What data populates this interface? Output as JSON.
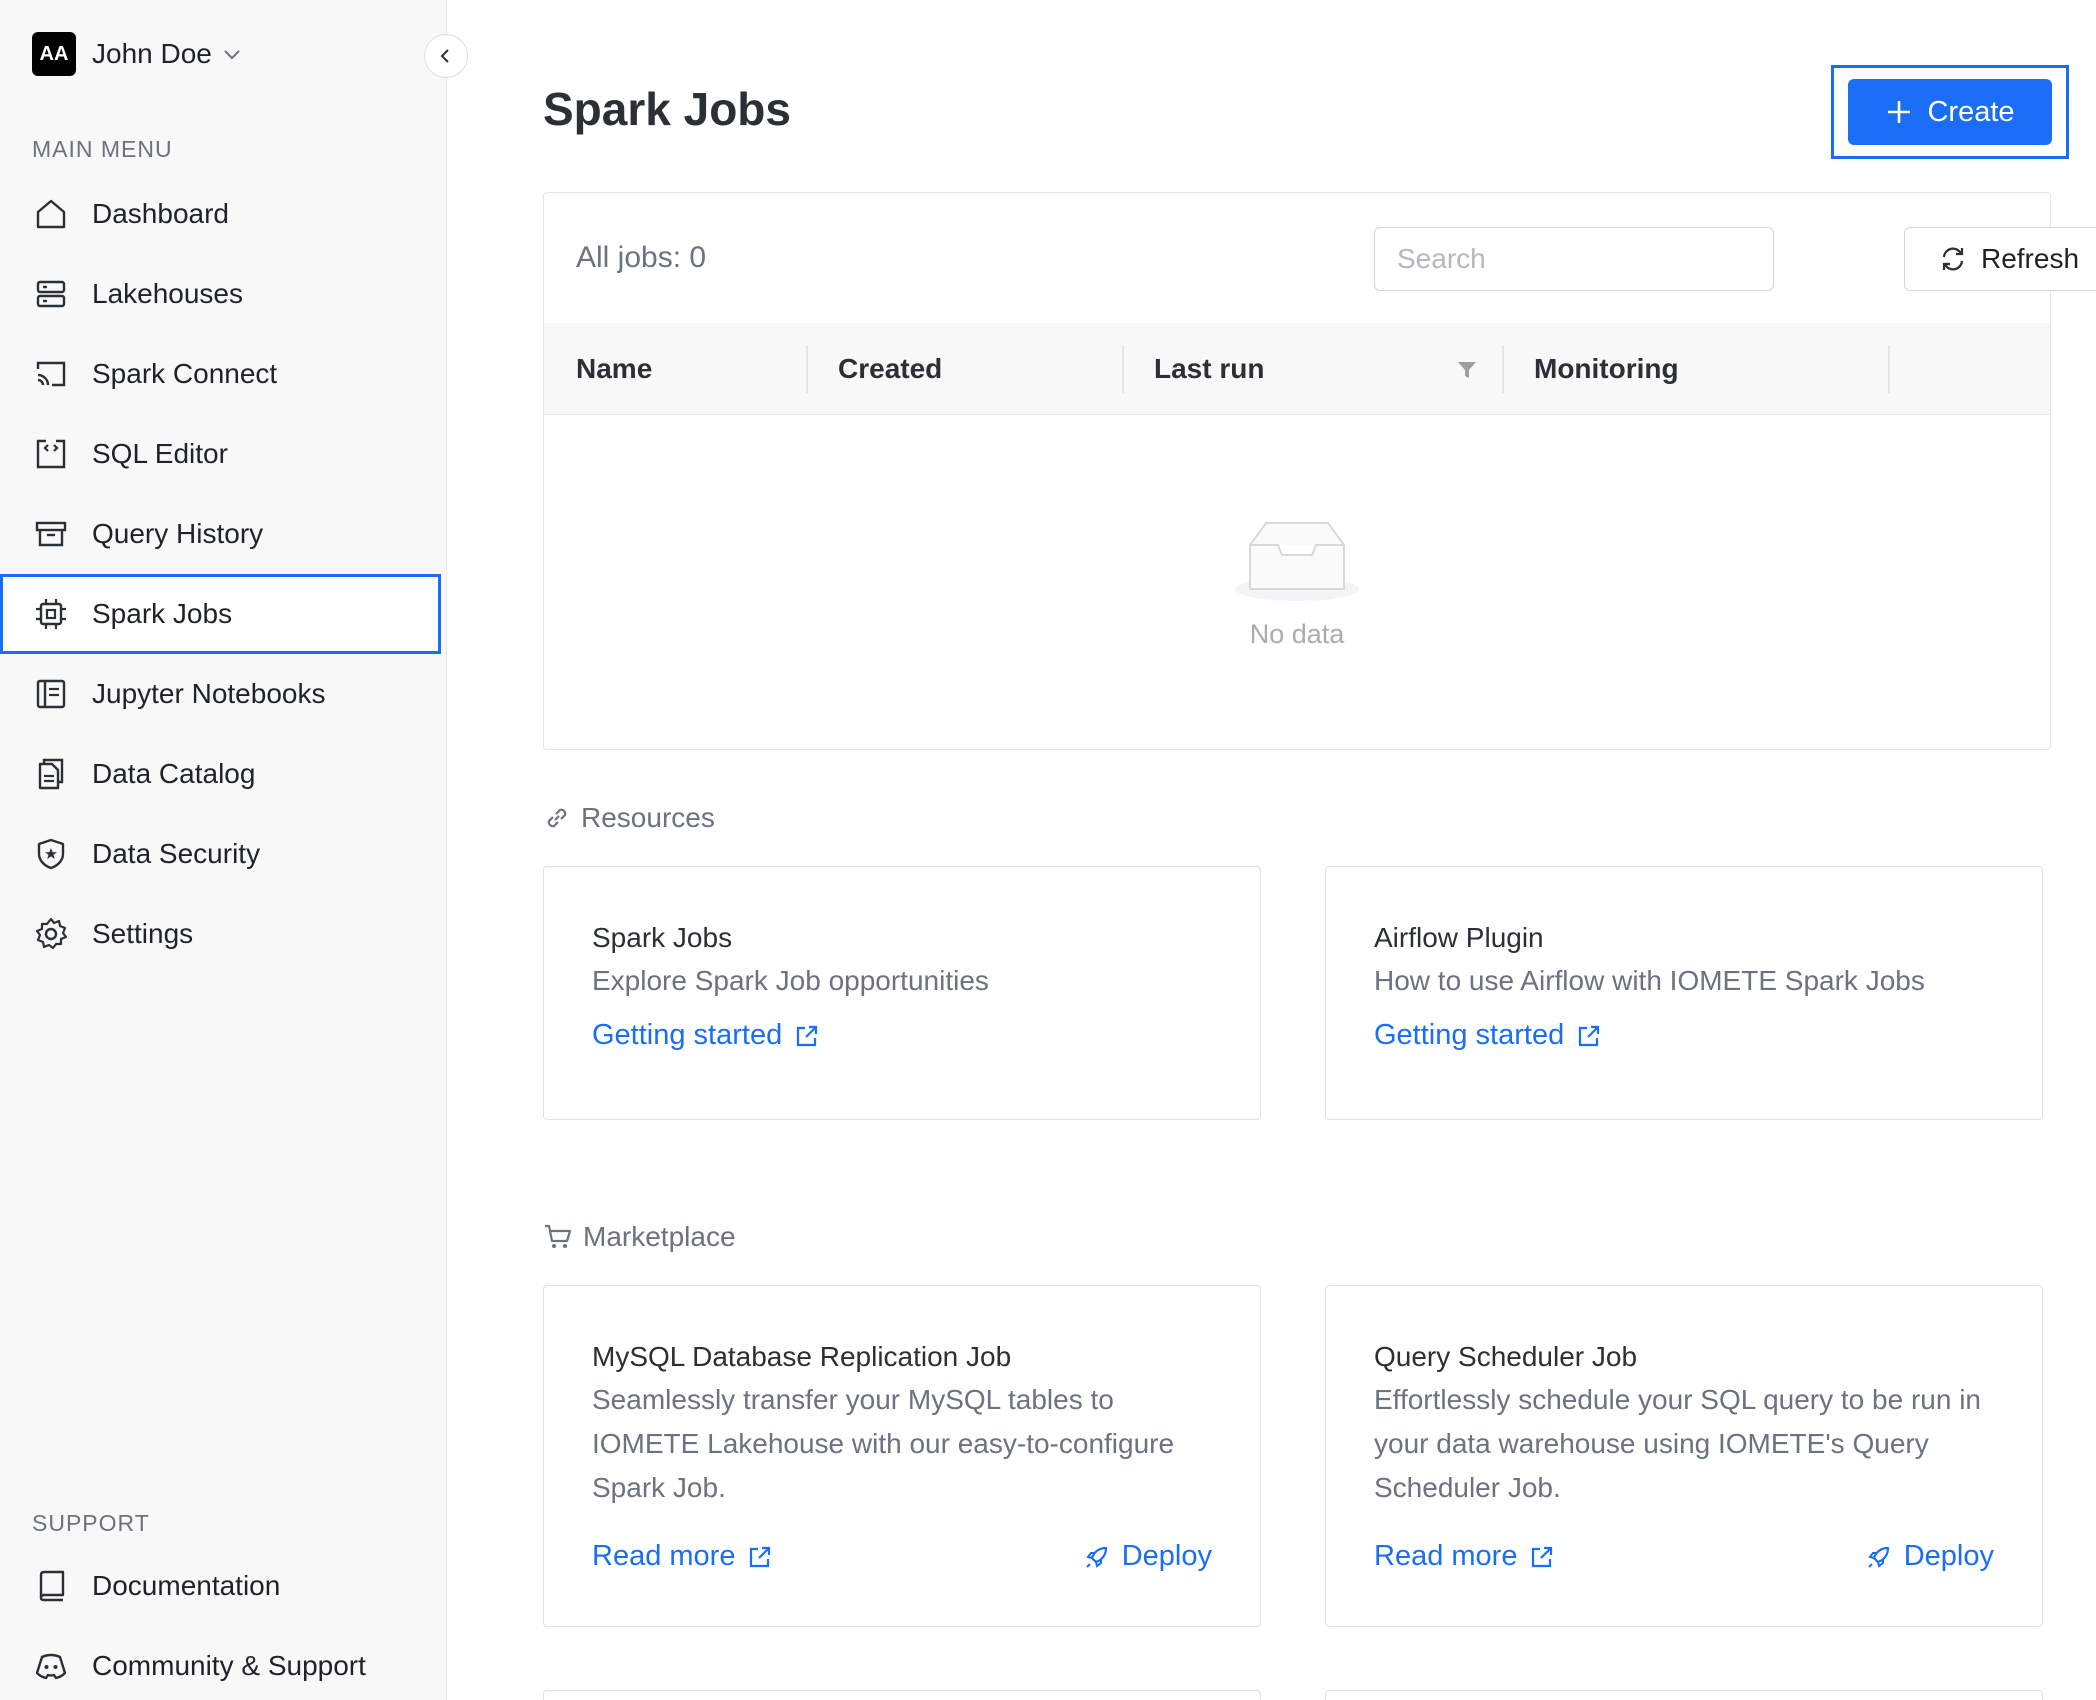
{
  "user": {
    "initials": "AA",
    "name": "John Doe"
  },
  "sidebar": {
    "main_menu_label": "MAIN MENU",
    "items": [
      {
        "label": "Dashboard",
        "icon": "home-icon"
      },
      {
        "label": "Lakehouses",
        "icon": "server-icon"
      },
      {
        "label": "Spark Connect",
        "icon": "cast-icon"
      },
      {
        "label": "SQL Editor",
        "icon": "code-file-icon"
      },
      {
        "label": "Query History",
        "icon": "archive-icon"
      },
      {
        "label": "Spark Jobs",
        "icon": "chip-icon",
        "active": true
      },
      {
        "label": "Jupyter Notebooks",
        "icon": "notebook-icon"
      },
      {
        "label": "Data Catalog",
        "icon": "catalog-icon"
      },
      {
        "label": "Data Security",
        "icon": "shield-star-icon"
      },
      {
        "label": "Settings",
        "icon": "gear-icon"
      }
    ],
    "support_label": "SUPPORT",
    "support_items": [
      {
        "label": "Documentation",
        "icon": "book-icon"
      },
      {
        "label": "Community & Support",
        "icon": "discord-icon"
      }
    ]
  },
  "header": {
    "title": "Spark Jobs",
    "create_label": "Create"
  },
  "jobs": {
    "count_label": "All jobs: 0",
    "search_placeholder": "Search",
    "refresh_label": "Refresh",
    "columns": [
      "Name",
      "Created",
      "Last run",
      "Monitoring"
    ],
    "empty_text": "No data"
  },
  "resources": {
    "heading": "Resources",
    "cards": [
      {
        "title": "Spark Jobs",
        "description": "Explore Spark Job opportunities",
        "link": "Getting started"
      },
      {
        "title": "Airflow Plugin",
        "description": "How to use Airflow with IOMETE Spark Jobs",
        "link": "Getting started"
      }
    ]
  },
  "marketplace": {
    "heading": "Marketplace",
    "cards": [
      {
        "title": "MySQL Database Replication Job",
        "description": "Seamlessly transfer your MySQL tables to IOMETE Lakehouse with our easy-to-configure Spark Job.",
        "read_more": "Read more",
        "deploy": "Deploy"
      },
      {
        "title": "Query Scheduler Job",
        "description": "Effortlessly schedule your SQL query to be run in your data warehouse using IOMETE's Query Scheduler Job.",
        "read_more": "Read more",
        "deploy": "Deploy"
      }
    ]
  },
  "colors": {
    "accent": "#1a6ef5",
    "sidebar_bg": "#f8f8f9"
  }
}
